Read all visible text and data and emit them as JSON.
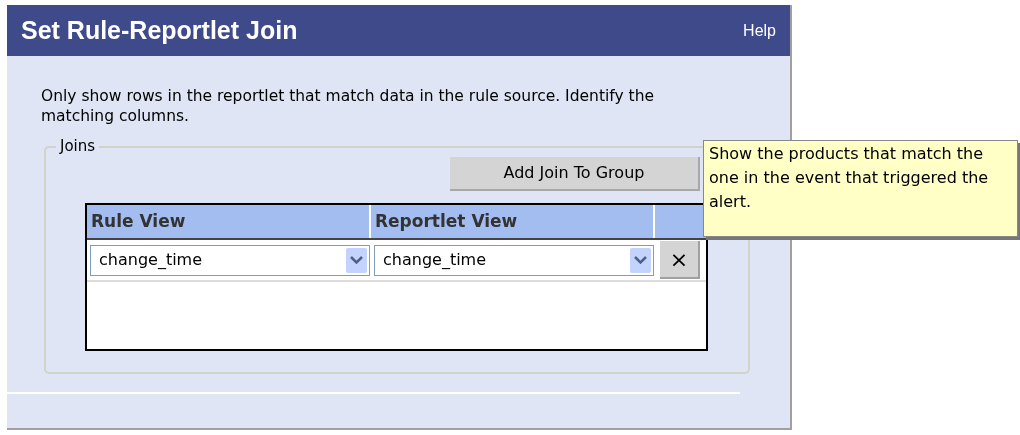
{
  "window": {
    "title": "Set Rule-Reportlet Join",
    "help": "Help"
  },
  "description": "Only show rows in the reportlet that match data in the rule source. Identify the matching columns.",
  "joins": {
    "legend": "Joins",
    "add_button": "Add Join To Group",
    "columns": [
      "Rule View",
      "Reportlet View"
    ],
    "rows": [
      {
        "rule_view": "change_time",
        "reportlet_view": "change_time",
        "remove": "×"
      }
    ]
  },
  "tooltip": "Show the products that match the one in the event that triggered the alert."
}
